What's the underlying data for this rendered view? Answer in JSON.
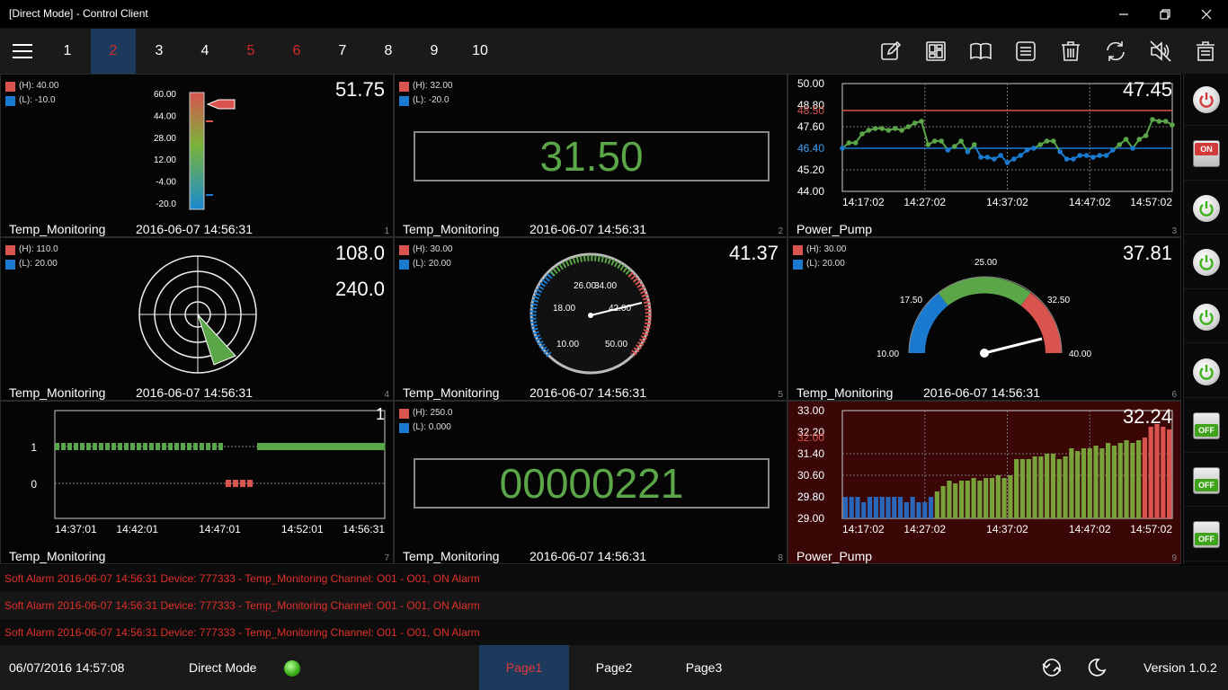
{
  "window": {
    "title": "[Direct Mode] - Control Client"
  },
  "toolbar": {
    "pages": [
      {
        "label": "1",
        "color": "white",
        "active": false
      },
      {
        "label": "2",
        "color": "red",
        "active": true
      },
      {
        "label": "3",
        "color": "white",
        "active": false
      },
      {
        "label": "4",
        "color": "white",
        "active": false
      },
      {
        "label": "5",
        "color": "red",
        "active": false
      },
      {
        "label": "6",
        "color": "red",
        "active": false
      },
      {
        "label": "7",
        "color": "white",
        "active": false
      },
      {
        "label": "8",
        "color": "white",
        "active": false
      },
      {
        "label": "9",
        "color": "white",
        "active": false
      },
      {
        "label": "10",
        "color": "white",
        "active": false
      }
    ],
    "icons": [
      "edit-icon",
      "dashboard-icon",
      "book-icon",
      "save-icon",
      "trash-icon",
      "refresh-icon",
      "mute-icon",
      "clear-icon"
    ]
  },
  "tiles": {
    "t1": {
      "high": "(H): 40.00",
      "low": "(L): -10.0",
      "value": "51.75",
      "name": "Temp_Monitoring",
      "date": "2016-06-07 14:56:31",
      "num": "1",
      "scale": [
        "60.00",
        "44.00",
        "28.00",
        "12.00",
        "-4.00",
        "-20.0"
      ]
    },
    "t2": {
      "high": "(H): 32.00",
      "low": "(L): -20.0",
      "digital": "31.50",
      "name": "Temp_Monitoring",
      "date": "2016-06-07 14:56:31",
      "num": "2"
    },
    "t3": {
      "value": "47.45",
      "name": "Power_Pump",
      "num": "3",
      "yticks": [
        "50.00",
        "48.80",
        "48.50",
        "47.60",
        "46.40",
        "46.40",
        "45.20",
        "44.00"
      ],
      "xticks": [
        "14:17:02",
        "14:27:02",
        "14:37:02",
        "14:47:02",
        "14:57:02"
      ]
    },
    "t4": {
      "high": "(H): 110.0",
      "low": "(L): 20.00",
      "value": "108.0",
      "value2": "240.0",
      "name": "Temp_Monitoring",
      "date": "2016-06-07 14:56:31",
      "num": "4"
    },
    "t5": {
      "high": "(H): 30.00",
      "low": "(L): 20.00",
      "value": "41.37",
      "name": "Temp_Monitoring",
      "date": "2016-06-07 14:56:31",
      "num": "5",
      "labels": [
        "26.00",
        "34.00",
        "18.00",
        "42.00",
        "10.00",
        "50.00"
      ]
    },
    "t6": {
      "high": "(H): 30.00",
      "low": "(L): 20.00",
      "value": "37.81",
      "name": "Temp_Monitoring",
      "date": "2016-06-07 14:56:31",
      "num": "6",
      "labels": [
        "25.00",
        "17.50",
        "32.50",
        "10.00",
        "40.00"
      ]
    },
    "t7": {
      "value": "1",
      "name": "Temp_Monitoring",
      "num": "7",
      "yticks": [
        "1",
        "0"
      ],
      "xticks": [
        "14:37:01",
        "14:42:01",
        "14:47:01",
        "14:52:01",
        "14:56:31"
      ]
    },
    "t8": {
      "high": "(H): 250.0",
      "low": "(L): 0.000",
      "digital": "00000221",
      "name": "Temp_Monitoring",
      "date": "2016-06-07 14:56:31",
      "num": "8"
    },
    "t9": {
      "value": "32.24",
      "name": "Power_Pump",
      "num": "9",
      "yticks": [
        "33.00",
        "32.20",
        "32.00",
        "31.40",
        "30.60",
        "29.80",
        "29.80",
        "29.00"
      ],
      "xticks": [
        "14:17:02",
        "14:27:02",
        "14:37:02",
        "14:47:02",
        "14:57:02"
      ]
    }
  },
  "sidebar": {
    "buttons": [
      {
        "type": "power",
        "state": "red"
      },
      {
        "type": "switch",
        "label": "ON",
        "state": "on"
      },
      {
        "type": "power",
        "state": "green"
      },
      {
        "type": "power",
        "state": "green"
      },
      {
        "type": "power",
        "state": "green"
      },
      {
        "type": "power",
        "state": "green"
      },
      {
        "type": "switch",
        "label": "OFF",
        "state": "off"
      },
      {
        "type": "switch",
        "label": "OFF",
        "state": "off"
      },
      {
        "type": "switch",
        "label": "OFF",
        "state": "off"
      }
    ]
  },
  "alarms": [
    "Soft Alarm 2016-06-07 14:56:31 Device: 777333 - Temp_Monitoring Channel: O01 - O01, ON Alarm",
    "Soft Alarm 2016-06-07 14:56:31 Device: 777333 - Temp_Monitoring Channel: O01 - O01, ON Alarm",
    "Soft Alarm 2016-06-07 14:56:31 Device: 777333 - Temp_Monitoring Channel: O01 - O01, ON Alarm"
  ],
  "status": {
    "datetime": "06/07/2016 14:57:08",
    "mode": "Direct Mode",
    "pages": [
      "Page1",
      "Page2",
      "Page3"
    ],
    "active_page": "Page1",
    "version": "Version 1.0.2"
  },
  "colors": {
    "accent_blue": "#1c3a5c",
    "alarm_red": "#e0302a",
    "ok_green": "#5aa648",
    "low_blue": "#1a7ad0",
    "high_red": "#d9534f"
  },
  "series": {
    "t3_line": [
      46.4,
      46.7,
      46.7,
      47.2,
      47.4,
      47.5,
      47.5,
      47.4,
      47.5,
      47.4,
      47.6,
      47.8,
      47.9,
      46.6,
      46.8,
      46.8,
      46.3,
      46.5,
      46.8,
      46.2,
      46.6,
      45.9,
      45.9,
      45.8,
      46.0,
      45.6,
      45.8,
      46.0,
      46.3,
      46.4,
      46.6,
      46.8,
      46.8,
      46.2,
      45.8,
      45.8,
      46.0,
      46.0,
      45.9,
      46.0,
      46.0,
      46.3,
      46.6,
      46.9,
      46.4,
      46.9,
      47.1,
      48.0,
      47.9,
      47.9,
      47.7
    ],
    "t7_points": [
      1,
      1,
      1,
      1,
      1,
      1,
      1,
      1,
      1,
      1,
      1,
      1,
      1,
      1,
      1,
      1,
      1,
      1,
      1,
      1,
      1,
      1,
      1,
      1,
      1,
      1,
      1,
      1,
      1,
      1,
      1,
      1,
      1,
      1,
      1,
      1,
      1,
      1,
      1,
      1,
      1,
      1,
      1,
      1,
      1,
      1,
      1,
      1,
      1,
      1,
      1,
      1,
      1,
      1,
      1,
      1,
      1,
      1,
      1,
      1
    ],
    "t7_zero_points": [
      0,
      0,
      0,
      0
    ],
    "t9_bars": [
      29.8,
      29.8,
      29.8,
      29.6,
      29.8,
      29.8,
      29.8,
      29.8,
      29.8,
      29.8,
      29.6,
      29.8,
      29.6,
      29.6,
      29.8,
      30.0,
      30.2,
      30.4,
      30.3,
      30.4,
      30.4,
      30.5,
      30.4,
      30.5,
      30.5,
      30.6,
      30.5,
      30.6,
      31.2,
      31.2,
      31.2,
      31.3,
      31.3,
      31.4,
      31.4,
      31.2,
      31.3,
      31.6,
      31.5,
      31.6,
      31.6,
      31.7,
      31.6,
      31.8,
      31.7,
      31.8,
      31.9,
      31.8,
      31.9,
      32.0,
      32.4,
      32.5,
      32.4,
      32.3
    ]
  }
}
